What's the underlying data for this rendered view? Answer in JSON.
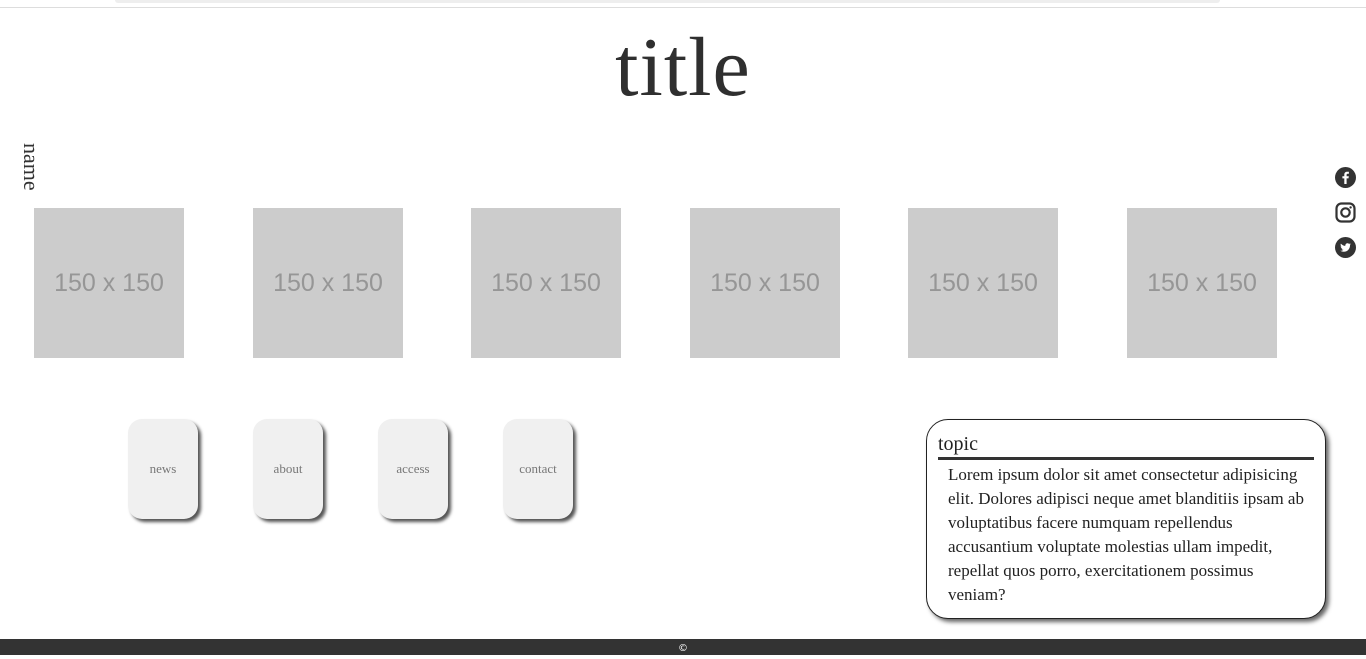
{
  "header": {
    "title": "title",
    "name": "name"
  },
  "social": [
    {
      "icon": "facebook-icon"
    },
    {
      "icon": "instagram-icon"
    },
    {
      "icon": "twitter-icon"
    }
  ],
  "gallery": {
    "items": [
      {
        "label": "150 x 150"
      },
      {
        "label": "150 x 150"
      },
      {
        "label": "150 x 150"
      },
      {
        "label": "150 x 150"
      },
      {
        "label": "150 x 150"
      },
      {
        "label": "150 x 150"
      }
    ]
  },
  "nav": {
    "items": [
      {
        "label": "news"
      },
      {
        "label": "about"
      },
      {
        "label": "access"
      },
      {
        "label": "contact"
      }
    ]
  },
  "topic": {
    "heading": "topic",
    "body": "Lorem ipsum dolor sit amet consectetur adipisicing elit. Dolores adipisci neque amet blanditiis ipsam ab voluptatibus facere numquam repellendus accusantium voluptate molestias ullam impedit, repellat quos porro, exercitationem possimus veniam?"
  },
  "footer": {
    "copyright": "©"
  },
  "colors": {
    "placeholder_bg": "#cccccc",
    "placeholder_text": "#969696",
    "footer_bg": "#333333",
    "button_bg": "#f0f0f0"
  }
}
